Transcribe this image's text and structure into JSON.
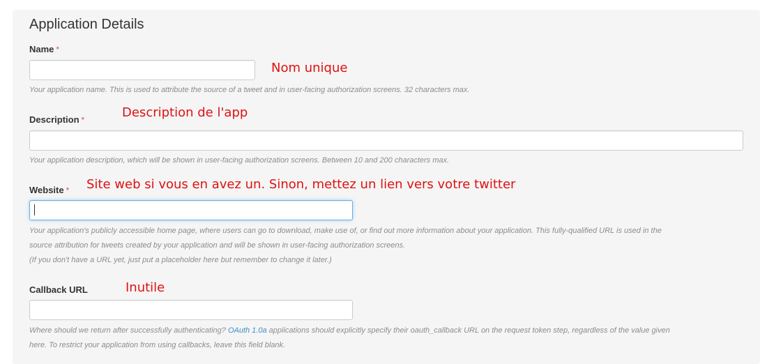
{
  "section": {
    "title": "Application Details"
  },
  "required_marker": "*",
  "fields": {
    "name": {
      "label": "Name",
      "value": "",
      "help": "Your application name. This is used to attribute the source of a tweet and in user-facing authorization screens. 32 characters max.",
      "annotation": "Nom unique"
    },
    "description": {
      "label": "Description",
      "value": "",
      "help": "Your application description, which will be shown in user-facing authorization screens. Between 10 and 200 characters max.",
      "annotation": "Description de l'app"
    },
    "website": {
      "label": "Website",
      "value": "",
      "help_line1": "Your application's publicly accessible home page, where users can go to download, make use of, or find out more information about your application. This fully-qualified URL is used in the",
      "help_line2": "source attribution for tweets created by your application and will be shown in user-facing authorization screens.",
      "help_line3": "(If you don't have a URL yet, just put a placeholder here but remember to change it later.)",
      "annotation": "Site web si vous en avez un. Sinon, mettez un lien vers votre twitter"
    },
    "callback": {
      "label": "Callback URL",
      "value": "",
      "help_prefix": "Where should we return after successfully authenticating? ",
      "help_link": "OAuth 1.0a",
      "help_suffix": " applications should explicitly specify their oauth_callback URL on the request token step, regardless of the value given",
      "help_line2": "here. To restrict your application from using callbacks, leave this field blank.",
      "annotation": "Inutile"
    }
  },
  "colors": {
    "panel_background": "#f5f5f5",
    "required_marker": "#d9534f",
    "annotation": "#e01010",
    "help_text": "#8c8c8c",
    "link": "#3b8ec2",
    "focus_border": "#66afe9"
  }
}
